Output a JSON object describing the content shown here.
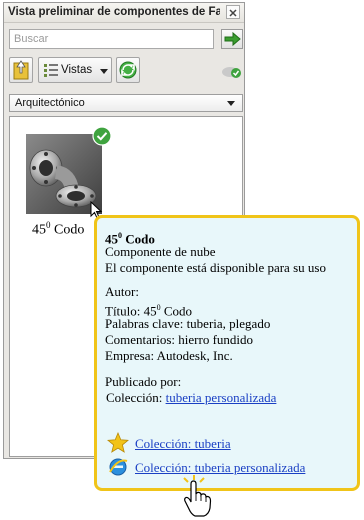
{
  "window": {
    "title": "Vista preliminar de componentes de Fa..."
  },
  "search": {
    "placeholder": "Buscar",
    "value": ""
  },
  "toolbar": {
    "views_label": "Vistas"
  },
  "category": {
    "selected": "Arquitectónico"
  },
  "component": {
    "name_base": "45",
    "name_sup": "0",
    "name_rest": " Codo"
  },
  "tooltip": {
    "title_base": "45",
    "title_sup": "0",
    "title_rest": " Codo",
    "type": "Componente de nube",
    "availability": "El componente está disponible para su uso",
    "author_label": "Autor:",
    "titulo_label": "Título: ",
    "titulo_base": "45",
    "titulo_sup": "0",
    "titulo_rest": " Codo",
    "keywords": "Palabras clave: tuberia, plegado",
    "comments": "Comentarios: hierro fundido",
    "company": "Empresa: Autodesk, Inc.",
    "published_by": "Publicado por:",
    "collection_label": "Colección: ",
    "collection_link": "tuberia personalizada",
    "link_1": "Colección: tuberia ",
    "link_2": "Colección: tuberia personalizada"
  },
  "colors": {
    "tooltip_border": "#f0c419",
    "tooltip_bg": "#e8f7fa",
    "link": "#1a3fc4",
    "check_green": "#3fa33f"
  }
}
